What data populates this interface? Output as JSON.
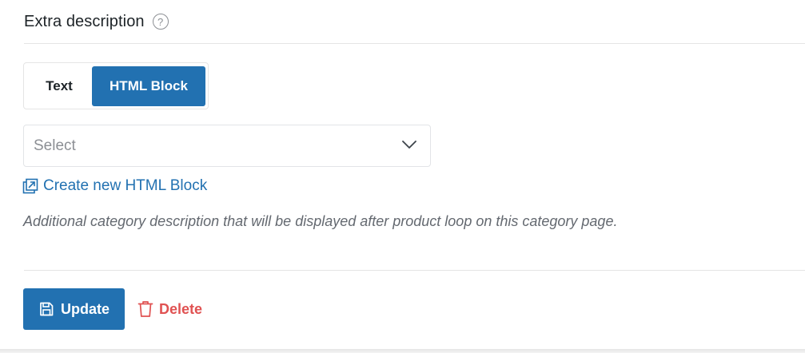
{
  "section": {
    "title": "Extra description",
    "help_glyph": "?",
    "help_icon": "question-circle-icon"
  },
  "toggle": {
    "options": [
      {
        "label": "Text",
        "selected": false
      },
      {
        "label": "HTML Block",
        "selected": true
      }
    ]
  },
  "select": {
    "placeholder": "Select",
    "icon": "chevron-down-icon"
  },
  "create_link": {
    "label": "Create new HTML Block",
    "icon": "external-link-icon"
  },
  "description": "Additional category description that will be displayed after product loop on this category page.",
  "actions": {
    "update_label": "Update",
    "update_icon": "save-icon",
    "delete_label": "Delete",
    "delete_icon": "trash-icon"
  },
  "colors": {
    "primary": "#2271b1",
    "danger": "#e05252",
    "muted_text": "#646970",
    "border": "#e5e5e5"
  }
}
